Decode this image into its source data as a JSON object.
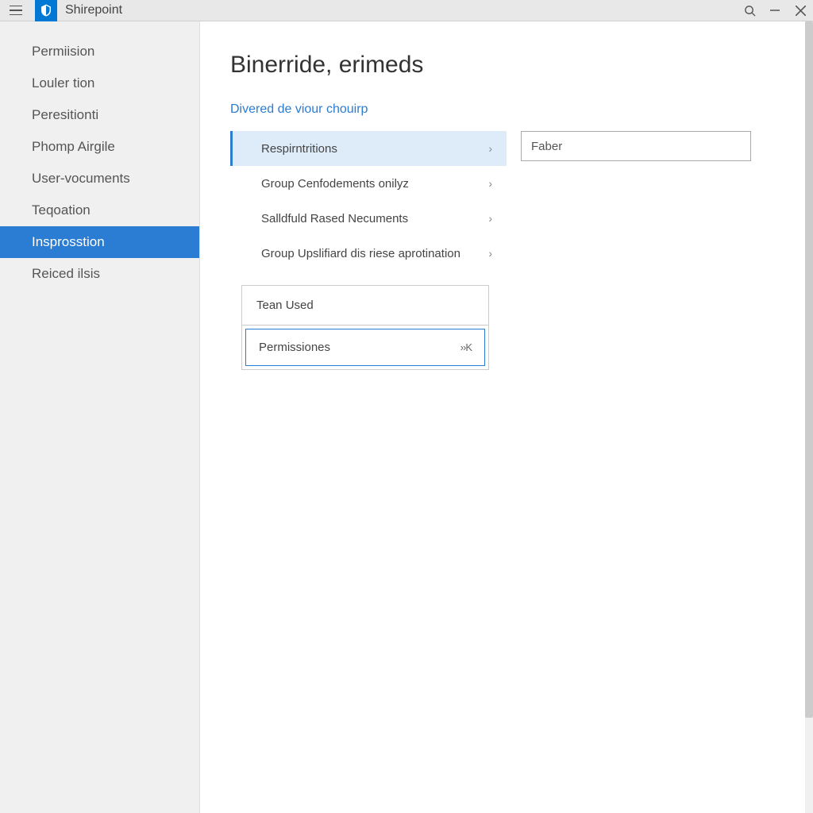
{
  "app": {
    "title": "Shirepoint"
  },
  "sidebar": {
    "items": [
      {
        "label": "Permiision"
      },
      {
        "label": "Louler tion"
      },
      {
        "label": "Peresitionti"
      },
      {
        "label": "Phomp Airgile"
      },
      {
        "label": "User-vocuments"
      },
      {
        "label": "Teqoation"
      },
      {
        "label": "Insprosstion"
      },
      {
        "label": "Reiced ilsis"
      }
    ],
    "active_index": 6
  },
  "main": {
    "title": "Binerride, erimeds",
    "subtitle_link": "Divered de viour chouirp",
    "settings": [
      {
        "label": "Respirntritions",
        "selected": true
      },
      {
        "label": "Group Cenfodements onilyz",
        "selected": false
      },
      {
        "label": "Salldfuld Rased Necuments",
        "selected": false
      },
      {
        "label": "Group Upslifiard dis riese aprotination",
        "selected": false
      }
    ],
    "input_value": "Faber",
    "card": {
      "header": "Tean Used",
      "item_label": "Permissiones",
      "item_action": "››K"
    }
  }
}
